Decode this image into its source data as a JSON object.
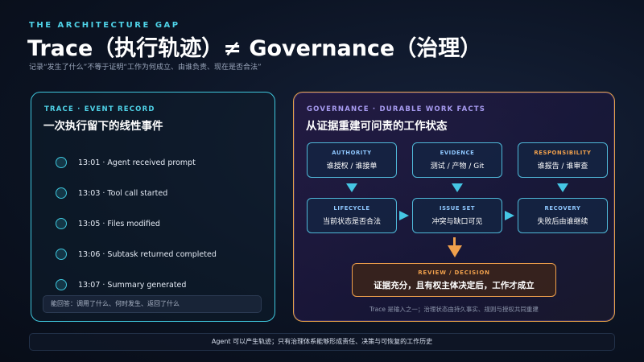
{
  "header": {
    "kicker": "THE ARCHITECTURE GAP",
    "title": "Trace（执行轨迹）≠ Governance（治理）",
    "subtitle": "记录“发生了什么”不等于证明“工作为何成立、由谁负责、现在是否合法”"
  },
  "trace_panel": {
    "kicker": "TRACE · EVENT RECORD",
    "title": "一次执行留下的线性事件",
    "events": [
      "13:01 · Agent received prompt",
      "13:03 · Tool call started",
      "13:05 · Files modified",
      "13:06 · Subtask returned completed",
      "13:07 · Summary generated"
    ],
    "answers": "能回答：调用了什么、何时发生、返回了什么"
  },
  "governance_panel": {
    "kicker": "GOVERNANCE · DURABLE WORK FACTS",
    "title": "从证据重建可问责的工作状态",
    "nodes": {
      "authority": {
        "label": "AUTHORITY",
        "text": "谁授权 / 谁接单"
      },
      "evidence": {
        "label": "EVIDENCE",
        "text": "测试 / 产物 / Git"
      },
      "responsibility": {
        "label": "RESPONSIBILITY",
        "text": "谁报告 / 谁审查"
      },
      "lifecycle": {
        "label": "LIFECYCLE",
        "text": "当前状态是否合法"
      },
      "issue_set": {
        "label": "ISSUE SET",
        "text": "冲突与缺口可见"
      },
      "recovery": {
        "label": "RECOVERY",
        "text": "失败后由谁继续"
      }
    },
    "decision": {
      "label": "REVIEW / DECISION",
      "text": "证据充分，且有权主体决定后，工作才成立"
    },
    "note": "Trace 是输入之一；治理状态由持久事实、规则与授权共同重建"
  },
  "footer": {
    "text": "Agent 可以产生轨迹；只有治理体系能够形成责任、决策与可恢复的工作历史"
  },
  "colors": {
    "cyan_accent": "#4fd3e8",
    "orange_accent": "#f0a04c",
    "violet_accent": "#a79bf0",
    "background": "#0c1424"
  }
}
